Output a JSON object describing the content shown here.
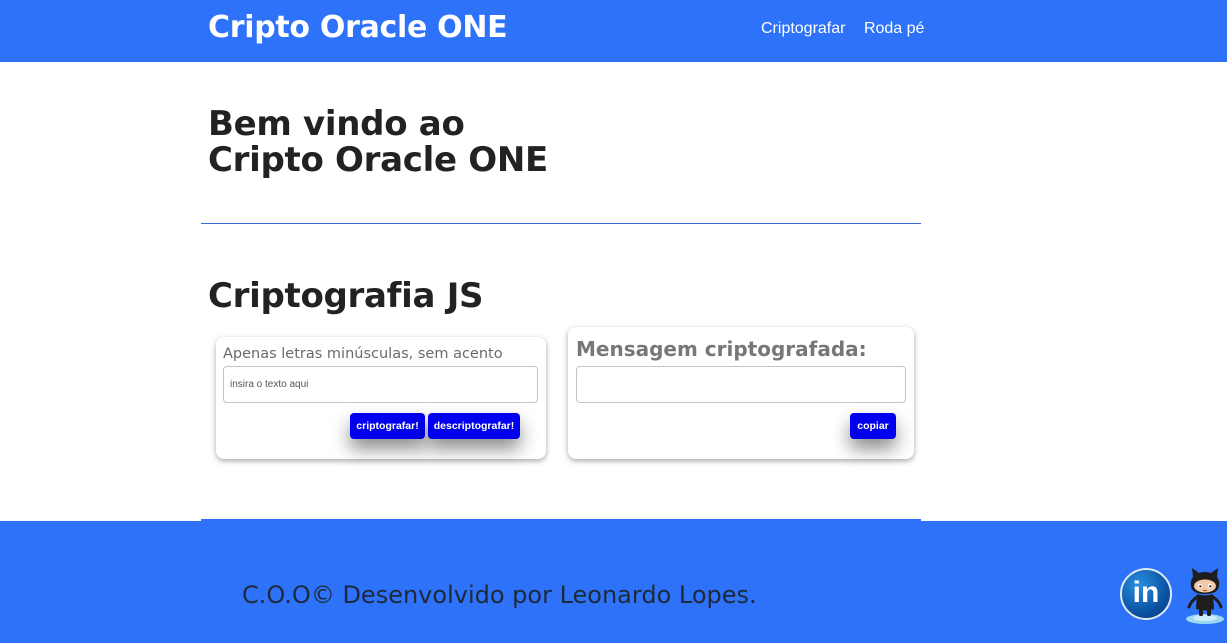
{
  "header": {
    "brand": "Cripto Oracle ONE",
    "nav": [
      "Criptografar",
      "Roda pé"
    ]
  },
  "welcome": {
    "line1": "Bem vindo ao",
    "line2": "Cripto Oracle ONE"
  },
  "section_title": "Criptografia JS",
  "encrypt_card": {
    "hint": "Apenas letras minúsculas, sem acento",
    "input_placeholder": "insira o texto aqui",
    "encrypt_label": "criptografar!",
    "decrypt_label": "descriptografar!"
  },
  "output_card": {
    "label": "Mensagem criptografada:",
    "output_value": "",
    "copy_label": "copiar"
  },
  "footer": {
    "text": "C.O.O© Desenvolvido por Leonardo Lopes.",
    "linkedin_glyph": "in",
    "icons": [
      "linkedin-icon",
      "github-octocat-icon"
    ]
  },
  "colors": {
    "primary": "#2d72f9",
    "button": "#0000ee",
    "text": "#222222",
    "muted": "#777777"
  }
}
